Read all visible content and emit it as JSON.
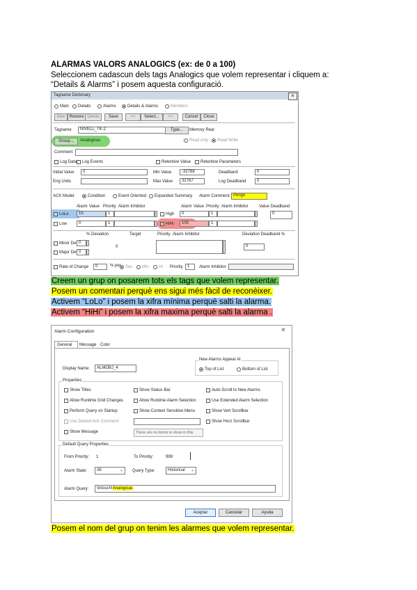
{
  "doc": {
    "heading": "ALARMAS VALORS ANALOGICS (ex: de 0 a 100)",
    "intro_line1": "Seleccionem cadascun dels tags Analogics que volem representar i cliquem a:",
    "intro_line2": "“Details & Alarms” i posem aquesta configuració.",
    "note_green": "Creem un grup on posarem tots els tags que volem representar.",
    "note_yellow": "Posem un comentari perquè ens sigui més fàcil de reconèixer.",
    "note_blue": "Activem “LoLo” i posem la xifra mínima perquè salti la alarma.",
    "note_red": "Activem “HiHi” i posem la xifra maxima perquè salti la alarma .",
    "note_final": "Posem el nom del grup on tenim les alarmes que volem representar."
  },
  "colors": {
    "green": "#6ccc5a",
    "yellow": "#ffff00",
    "blue": "#97c2ea",
    "red": "#f08282"
  },
  "tagdict": {
    "title": "Tagname Dictionary",
    "close": "×",
    "radios": [
      "Main",
      "Details",
      "Alarms",
      "Details & Alarms",
      "Members"
    ],
    "buttons": [
      "New",
      "Restore",
      "Delete",
      "Save",
      "<<",
      "Select...",
      ">>",
      "Cancel",
      "Close"
    ],
    "tagname_label": "Tagname",
    "tagname_value": "NIVELL_TK-2",
    "type_button": "Type...",
    "type_value": "Memory Real",
    "group_button": "Group...",
    "group_value": "Analogicas",
    "readonly": "Read only",
    "readwrite": "Read Write",
    "comment_label": "Comment:",
    "log_data": "Log Data",
    "log_events": "Log Events",
    "retentive_value": "Retentive Value",
    "retentive_params": "Retentive Parameters",
    "initial_label": "Initial Value",
    "initial_value": "0",
    "eng_label": "Eng Units",
    "min_label": "Min Value",
    "min_value": "-32768",
    "max_label": "Max Value",
    "max_value": "32767",
    "deadband_label": "Deadband",
    "deadband_value": "0",
    "logdead_label": "Log Deadband",
    "logdead_value": "0",
    "ack_label": "ACK Model:",
    "ack_opts": [
      "Condition",
      "Event Oriented",
      "Expanded Summary"
    ],
    "alarm_comment_label": "Alarm Comment:",
    "alarm_comment_value": "Perigo",
    "col_left": [
      "Alarm",
      "Value",
      "Priority",
      "Alarm Inhibitor"
    ],
    "col_right": [
      "Alarm",
      "Value",
      "Priority",
      "Alarm Inhibitor",
      "Value Deadband"
    ],
    "lolo": "LoLo",
    "lolo_value": "15",
    "lolo_pri": "1",
    "low": "Low",
    "low_value": "0",
    "low_pri": "1",
    "high": "High",
    "high_value": "0",
    "high_pri": "1",
    "hihi": "HiHi",
    "hihi_value": "100",
    "hihi_pri": "1",
    "deadband_val": "0",
    "dev_headers": [
      "% Deviation",
      "Target",
      "Priority",
      "Alarm Inhibitor",
      "Deviation Deadband %"
    ],
    "minor": "Minor Deviation",
    "minor_value": "0",
    "major": "Major Deviation",
    "major_value": "0",
    "target_value": "0",
    "dev_deadband": "0",
    "roc": "Rate of Change",
    "roc_value": "0",
    "roc_per": "% per",
    "roc_units": [
      "Sec",
      "Min",
      "Hr"
    ],
    "roc_priority": "Priority",
    "roc_pri_value": "1",
    "roc_inhibitor": "Alarm Inhibitor"
  },
  "alarmcfg": {
    "title": "Alarm Configuration",
    "close": "×",
    "tabs": [
      "General",
      "Message",
      "Color"
    ],
    "display_label": "Display Name:",
    "display_value": "ALMOBJ_4",
    "new_alarm": "New Alarms Appear At",
    "top": "Top of List",
    "bottom": "Bottom of List",
    "properties": "Properties",
    "props": [
      [
        "Show Titles",
        "Show Status Bar",
        "Auto-Scroll to New Alarms"
      ],
      [
        "Allow Runtime Grid Changes",
        "Allow Runtime Alarm Selection",
        "Use Extended Alarm Selection"
      ],
      [
        "Perform Query on Startup",
        "Show Context Sensitive Menu",
        "Show Vert Scrollbar"
      ],
      [
        "Use Default Ack Comment",
        "",
        "Show Horz Scrollbar"
      ],
      [
        "Show Message",
        "There are no items to show in this",
        ""
      ]
    ],
    "dq": "Default Query Properties",
    "from_label": "From Priority:",
    "from_value": "1",
    "to_label": "To Priority:",
    "to_value": "999",
    "state_label": "Alarm State:",
    "state_value": "All",
    "qtype_label": "Query Type:",
    "qtype_value": "Historical",
    "query_label": "Alarm Query:",
    "query_prefix": "\\intouch!",
    "query_group": "Analogicas",
    "ok": "Aceptar",
    "cancel": "Cancelar",
    "help": "Ayuda"
  }
}
